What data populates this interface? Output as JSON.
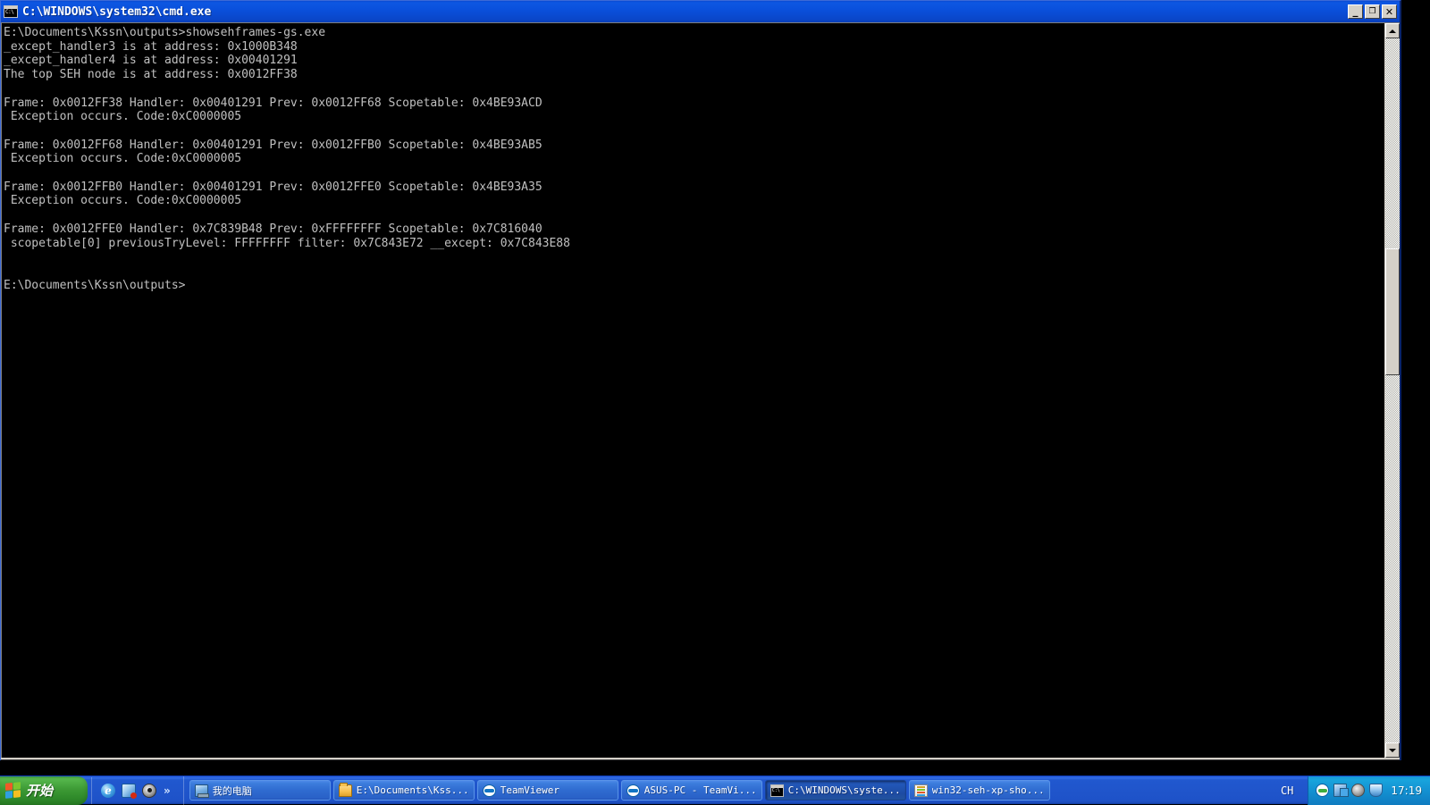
{
  "window": {
    "title": "C:\\WINDOWS\\system32\\cmd.exe",
    "icon": "cmd-console-icon",
    "minimize_label": "_",
    "restore_label": "❐",
    "close_label": "✕"
  },
  "console": {
    "background": "#000000",
    "foreground": "#c0c0c0",
    "lines": [
      "E:\\Documents\\Kssn\\outputs>showsehframes-gs.exe",
      "_except_handler3 is at address: 0x1000B348",
      "_except_handler4 is at address: 0x00401291",
      "The top SEH node is at address: 0x0012FF38",
      "",
      "Frame: 0x0012FF38 Handler: 0x00401291 Prev: 0x0012FF68 Scopetable: 0x4BE93ACD",
      " Exception occurs. Code:0xC0000005",
      "",
      "Frame: 0x0012FF68 Handler: 0x00401291 Prev: 0x0012FFB0 Scopetable: 0x4BE93AB5",
      " Exception occurs. Code:0xC0000005",
      "",
      "Frame: 0x0012FFB0 Handler: 0x00401291 Prev: 0x0012FFE0 Scopetable: 0x4BE93A35",
      " Exception occurs. Code:0xC0000005",
      "",
      "Frame: 0x0012FFE0 Handler: 0x7C839B48 Prev: 0xFFFFFFFF Scopetable: 0x7C816040",
      " scopetable[0] previousTryLevel: FFFFFFFF filter: 0x7C843E72 __except: 0x7C843E88",
      "",
      "",
      "E:\\Documents\\Kssn\\outputs>"
    ]
  },
  "scrollbar": {
    "up_arrow": "▲",
    "down_arrow": "▼"
  },
  "taskbar": {
    "start_label": "开始",
    "quick_launch": [
      {
        "name": "internet-explorer-icon",
        "glyph": "e"
      },
      {
        "name": "show-desktop-icon",
        "glyph": ""
      },
      {
        "name": "media-player-icon",
        "glyph": ""
      }
    ],
    "quick_launch_chevron": "»",
    "tasks": [
      {
        "label": "我的电脑",
        "icon": "my-computer-icon",
        "active": false
      },
      {
        "label": "E:\\Documents\\Kss...",
        "icon": "folder-icon",
        "active": false
      },
      {
        "label": "TeamViewer",
        "icon": "teamviewer-icon",
        "active": false
      },
      {
        "label": "ASUS-PC - TeamVi...",
        "icon": "teamviewer-icon",
        "active": false
      },
      {
        "label": "C:\\WINDOWS\\syste...",
        "icon": "cmd-console-icon",
        "active": true
      },
      {
        "label": "win32-seh-xp-sho...",
        "icon": "app-window-icon",
        "active": false
      }
    ],
    "language_indicator": "CH",
    "tray_icons": [
      "teamviewer-tray-icon",
      "network-connection-icon",
      "volume-icon",
      "security-center-icon"
    ],
    "clock": "17:19"
  }
}
